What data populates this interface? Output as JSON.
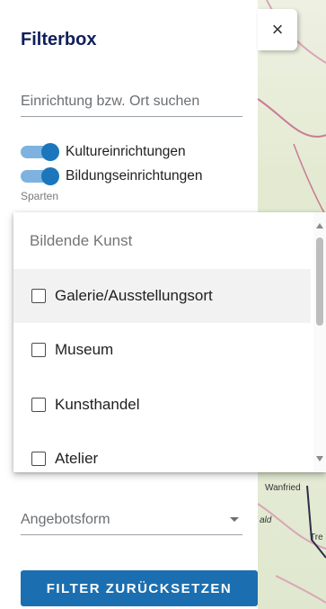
{
  "panel": {
    "title": "Filterbox",
    "close_icon": "×",
    "search": {
      "placeholder": "Einrichtung bzw. Ort suchen"
    },
    "toggles": [
      {
        "label": "Kultureinrichtungen",
        "on": true
      },
      {
        "label": "Bildungseinrichtungen",
        "on": true
      }
    ],
    "sparten_label": "Sparten",
    "dropdown": {
      "group_header": "Bildende Kunst",
      "options": [
        {
          "label": "Galerie/Ausstellungsort",
          "checked": false
        },
        {
          "label": "Museum",
          "checked": false
        },
        {
          "label": "Kunsthandel",
          "checked": false
        },
        {
          "label": "Atelier",
          "checked": false
        }
      ]
    },
    "angebotsform": {
      "placeholder": "Angebotsform"
    },
    "reset_label": "FILTER ZURÜCKSETZEN"
  },
  "map": {
    "labels": [
      "Wanfried",
      "ald",
      "Tre"
    ]
  },
  "colors": {
    "title": "#0f1f5c",
    "toggle_track": "#7db3de",
    "toggle_knob": "#1b76bc",
    "button": "#1b6fb0"
  }
}
